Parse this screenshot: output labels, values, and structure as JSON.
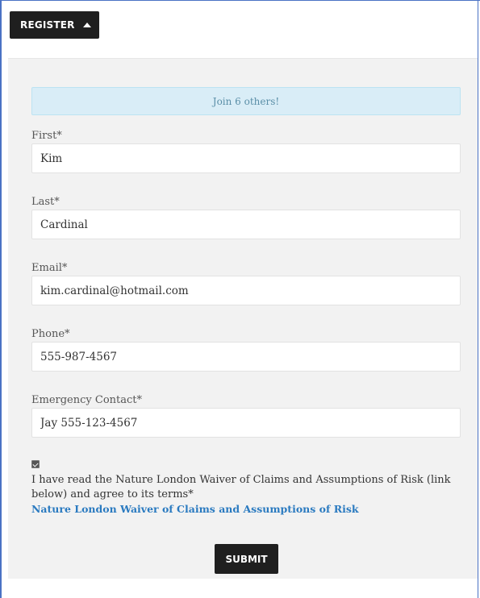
{
  "toggle": {
    "label": "REGISTER",
    "icon": "caret-up-icon"
  },
  "banner": {
    "text": "Join 6 others!"
  },
  "form": {
    "first": {
      "label": "First*",
      "value": "Kim"
    },
    "last": {
      "label": "Last*",
      "value": "Cardinal"
    },
    "email": {
      "label": "Email*",
      "value": "kim.cardinal@hotmail.com"
    },
    "phone": {
      "label": "Phone*",
      "value": "555-987-4567"
    },
    "emergency": {
      "label": "Emergency Contact*",
      "value": "Jay 555-123-4567"
    }
  },
  "terms": {
    "checked": true,
    "text": "I have read the Nature London Waiver of Claims and Assumptions of Risk (link below) and agree to its terms*",
    "link_text": "Nature London Waiver of Claims and Assumptions of Risk"
  },
  "submit": {
    "label": "SUBMIT"
  },
  "colors": {
    "frame": "#4a72c4",
    "button": "#1f1f1f",
    "panel": "#f2f2f2",
    "banner_bg": "#d9edf7",
    "banner_text": "#5b8fa8",
    "link": "#2a7ac0"
  }
}
